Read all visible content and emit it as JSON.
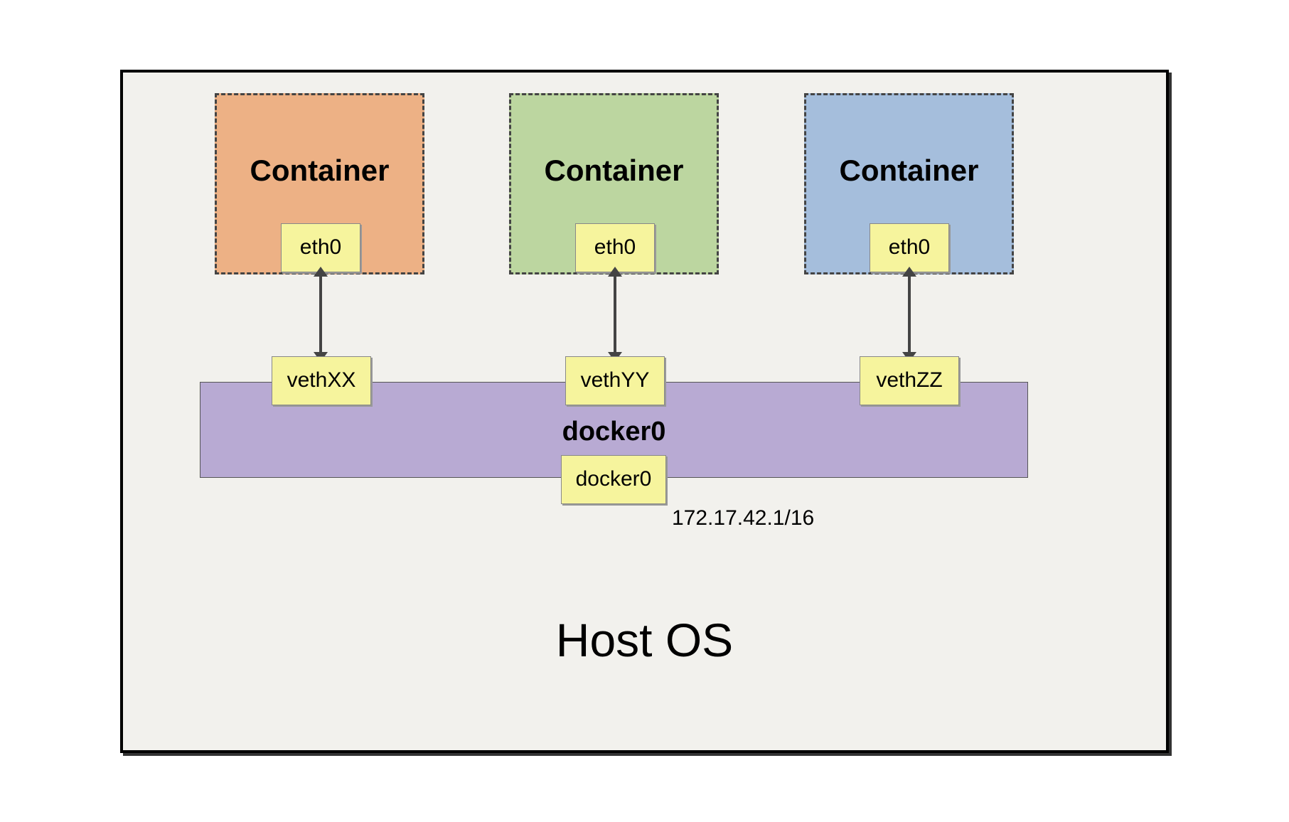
{
  "host_label": "Host OS",
  "containers": [
    {
      "title": "Container",
      "eth": "eth0",
      "veth": "vethXX"
    },
    {
      "title": "Container",
      "eth": "eth0",
      "veth": "vethYY"
    },
    {
      "title": "Container",
      "eth": "eth0",
      "veth": "vethZZ"
    }
  ],
  "bridge": {
    "title": "docker0",
    "interface": "docker0",
    "ip": "172.17.42.1/16"
  }
}
